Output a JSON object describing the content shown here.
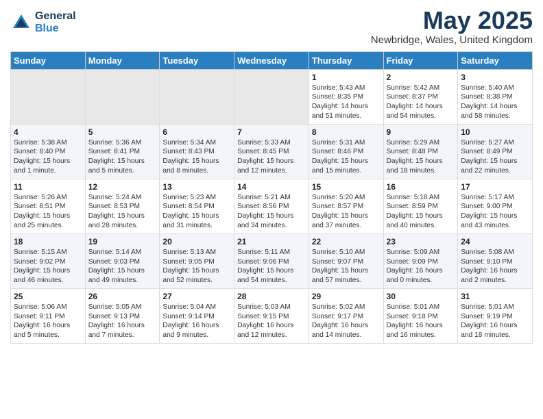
{
  "header": {
    "logo_general": "General",
    "logo_blue": "Blue",
    "month_title": "May 2025",
    "location": "Newbridge, Wales, United Kingdom"
  },
  "days_of_week": [
    "Sunday",
    "Monday",
    "Tuesday",
    "Wednesday",
    "Thursday",
    "Friday",
    "Saturday"
  ],
  "weeks": [
    [
      {
        "day": "",
        "content": ""
      },
      {
        "day": "",
        "content": ""
      },
      {
        "day": "",
        "content": ""
      },
      {
        "day": "",
        "content": ""
      },
      {
        "day": "1",
        "content": "Sunrise: 5:43 AM\nSunset: 8:35 PM\nDaylight: 14 hours\nand 51 minutes."
      },
      {
        "day": "2",
        "content": "Sunrise: 5:42 AM\nSunset: 8:37 PM\nDaylight: 14 hours\nand 54 minutes."
      },
      {
        "day": "3",
        "content": "Sunrise: 5:40 AM\nSunset: 8:38 PM\nDaylight: 14 hours\nand 58 minutes."
      }
    ],
    [
      {
        "day": "4",
        "content": "Sunrise: 5:38 AM\nSunset: 8:40 PM\nDaylight: 15 hours\nand 1 minute."
      },
      {
        "day": "5",
        "content": "Sunrise: 5:36 AM\nSunset: 8:41 PM\nDaylight: 15 hours\nand 5 minutes."
      },
      {
        "day": "6",
        "content": "Sunrise: 5:34 AM\nSunset: 8:43 PM\nDaylight: 15 hours\nand 8 minutes."
      },
      {
        "day": "7",
        "content": "Sunrise: 5:33 AM\nSunset: 8:45 PM\nDaylight: 15 hours\nand 12 minutes."
      },
      {
        "day": "8",
        "content": "Sunrise: 5:31 AM\nSunset: 8:46 PM\nDaylight: 15 hours\nand 15 minutes."
      },
      {
        "day": "9",
        "content": "Sunrise: 5:29 AM\nSunset: 8:48 PM\nDaylight: 15 hours\nand 18 minutes."
      },
      {
        "day": "10",
        "content": "Sunrise: 5:27 AM\nSunset: 8:49 PM\nDaylight: 15 hours\nand 22 minutes."
      }
    ],
    [
      {
        "day": "11",
        "content": "Sunrise: 5:26 AM\nSunset: 8:51 PM\nDaylight: 15 hours\nand 25 minutes."
      },
      {
        "day": "12",
        "content": "Sunrise: 5:24 AM\nSunset: 8:53 PM\nDaylight: 15 hours\nand 28 minutes."
      },
      {
        "day": "13",
        "content": "Sunrise: 5:23 AM\nSunset: 8:54 PM\nDaylight: 15 hours\nand 31 minutes."
      },
      {
        "day": "14",
        "content": "Sunrise: 5:21 AM\nSunset: 8:56 PM\nDaylight: 15 hours\nand 34 minutes."
      },
      {
        "day": "15",
        "content": "Sunrise: 5:20 AM\nSunset: 8:57 PM\nDaylight: 15 hours\nand 37 minutes."
      },
      {
        "day": "16",
        "content": "Sunrise: 5:18 AM\nSunset: 8:59 PM\nDaylight: 15 hours\nand 40 minutes."
      },
      {
        "day": "17",
        "content": "Sunrise: 5:17 AM\nSunset: 9:00 PM\nDaylight: 15 hours\nand 43 minutes."
      }
    ],
    [
      {
        "day": "18",
        "content": "Sunrise: 5:15 AM\nSunset: 9:02 PM\nDaylight: 15 hours\nand 46 minutes."
      },
      {
        "day": "19",
        "content": "Sunrise: 5:14 AM\nSunset: 9:03 PM\nDaylight: 15 hours\nand 49 minutes."
      },
      {
        "day": "20",
        "content": "Sunrise: 5:13 AM\nSunset: 9:05 PM\nDaylight: 15 hours\nand 52 minutes."
      },
      {
        "day": "21",
        "content": "Sunrise: 5:11 AM\nSunset: 9:06 PM\nDaylight: 15 hours\nand 54 minutes."
      },
      {
        "day": "22",
        "content": "Sunrise: 5:10 AM\nSunset: 9:07 PM\nDaylight: 15 hours\nand 57 minutes."
      },
      {
        "day": "23",
        "content": "Sunrise: 5:09 AM\nSunset: 9:09 PM\nDaylight: 16 hours\nand 0 minutes."
      },
      {
        "day": "24",
        "content": "Sunrise: 5:08 AM\nSunset: 9:10 PM\nDaylight: 16 hours\nand 2 minutes."
      }
    ],
    [
      {
        "day": "25",
        "content": "Sunrise: 5:06 AM\nSunset: 9:11 PM\nDaylight: 16 hours\nand 5 minutes."
      },
      {
        "day": "26",
        "content": "Sunrise: 5:05 AM\nSunset: 9:13 PM\nDaylight: 16 hours\nand 7 minutes."
      },
      {
        "day": "27",
        "content": "Sunrise: 5:04 AM\nSunset: 9:14 PM\nDaylight: 16 hours\nand 9 minutes."
      },
      {
        "day": "28",
        "content": "Sunrise: 5:03 AM\nSunset: 9:15 PM\nDaylight: 16 hours\nand 12 minutes."
      },
      {
        "day": "29",
        "content": "Sunrise: 5:02 AM\nSunset: 9:17 PM\nDaylight: 16 hours\nand 14 minutes."
      },
      {
        "day": "30",
        "content": "Sunrise: 5:01 AM\nSunset: 9:18 PM\nDaylight: 16 hours\nand 16 minutes."
      },
      {
        "day": "31",
        "content": "Sunrise: 5:01 AM\nSunset: 9:19 PM\nDaylight: 16 hours\nand 18 minutes."
      }
    ]
  ]
}
